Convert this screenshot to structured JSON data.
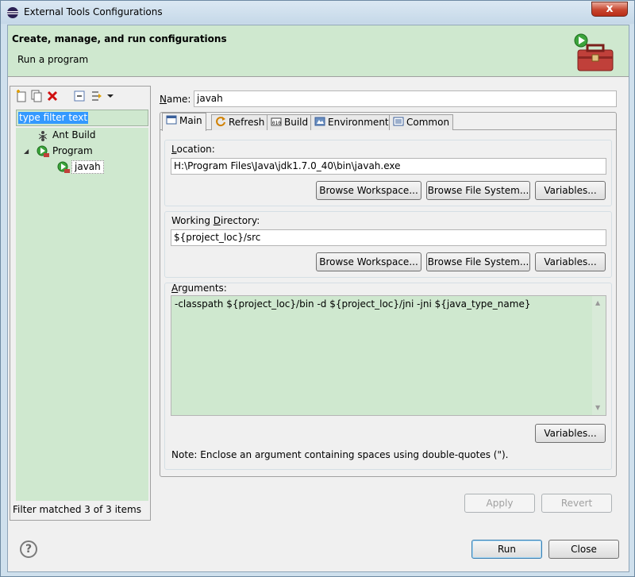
{
  "window": {
    "title": "External Tools Configurations",
    "close_glyph": "x"
  },
  "banner": {
    "heading": "Create, manage, and run configurations",
    "subheading": "Run a program"
  },
  "left": {
    "filter_placeholder": "type filter text",
    "tree": [
      {
        "label": "Ant Build",
        "icon": "ant-icon"
      },
      {
        "label": "Program",
        "icon": "program-icon",
        "expanded_glyph": "◢"
      },
      {
        "label": "javah",
        "icon": "program-launch-icon"
      }
    ],
    "footer": "Filter matched 3 of 3 items"
  },
  "right": {
    "name_label_pre": "N",
    "name_label_post": "ame:",
    "name_value": "javah",
    "tabs": [
      {
        "label": "Main",
        "icon": "main-tab-icon"
      },
      {
        "label": "Refresh",
        "icon": "refresh-icon"
      },
      {
        "label": "Build",
        "icon": "build-icon"
      },
      {
        "label": "Environment",
        "icon": "environment-icon"
      },
      {
        "label": "Common",
        "icon": "common-icon"
      }
    ],
    "location": {
      "title_pre": "L",
      "title_post": "ocation:",
      "value": "H:\\Program Files\\Java\\jdk1.7.0_40\\bin\\javah.exe",
      "browse_workspace": "Browse Workspace...",
      "browse_fs": "Browse File System...",
      "variables": "Variables..."
    },
    "workdir": {
      "title_a": "Working ",
      "title_u": "D",
      "title_b": "irectory:",
      "value": "${project_loc}/src",
      "browse_workspace": "Browse Workspace...",
      "browse_fs": "Browse File System...",
      "variables": "Variables..."
    },
    "arguments": {
      "title_pre": "A",
      "title_post": "rguments:",
      "value": "-classpath ${project_loc}/bin -d ${project_loc}/jni -jni ${java_type_name}",
      "variables": "Variables...",
      "note": "Note: Enclose an argument containing spaces using double-quotes (\")."
    },
    "apply": "Apply",
    "revert": "Revert"
  },
  "footer": {
    "help": "?",
    "run": "Run",
    "close": "Close"
  }
}
